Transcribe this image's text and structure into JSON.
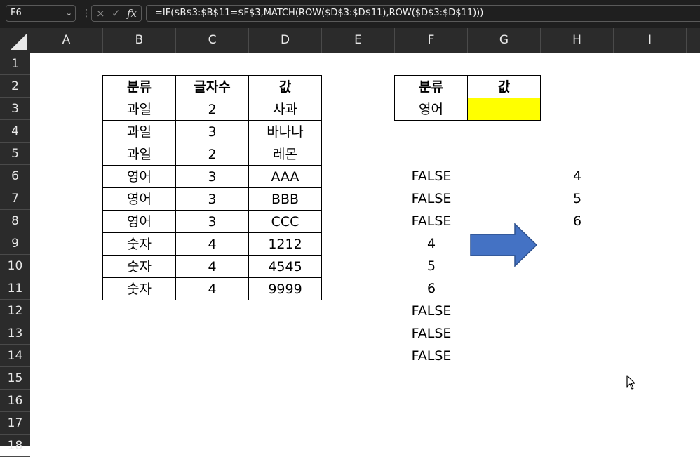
{
  "namebox": {
    "value": "F6",
    "chevron": "⌄"
  },
  "formula_bar": {
    "cancel_icon": "×",
    "enter_icon": "✓",
    "fx_label": "fx",
    "formula": "=IF($B$3:$B$11=$F$3,MATCH(ROW($D$3:$D$11),ROW($D$3:$D$11)))"
  },
  "columns": [
    "A",
    "B",
    "C",
    "D",
    "E",
    "F",
    "G",
    "H",
    "I"
  ],
  "rows": [
    "1",
    "2",
    "3",
    "4",
    "5",
    "6",
    "7",
    "8",
    "9",
    "10",
    "11",
    "12",
    "13",
    "14",
    "15",
    "16",
    "17",
    "18"
  ],
  "source_table": {
    "headers": [
      "분류",
      "글자수",
      "값"
    ],
    "rows": [
      [
        "과일",
        "2",
        "사과"
      ],
      [
        "과일",
        "3",
        "바나나"
      ],
      [
        "과일",
        "2",
        "레몬"
      ],
      [
        "영어",
        "3",
        "AAA"
      ],
      [
        "영어",
        "3",
        "BBB"
      ],
      [
        "영어",
        "3",
        "CCC"
      ],
      [
        "숫자",
        "4",
        "1212"
      ],
      [
        "숫자",
        "4",
        "4545"
      ],
      [
        "숫자",
        "4",
        "9999"
      ]
    ]
  },
  "lookup_table": {
    "headers": [
      "분류",
      "값"
    ],
    "category": "영어",
    "value": "",
    "highlight_color": "#ffff00"
  },
  "f_results": [
    "FALSE",
    "FALSE",
    "FALSE",
    "4",
    "5",
    "6",
    "FALSE",
    "FALSE",
    "FALSE"
  ],
  "h_results": [
    "4",
    "5",
    "6"
  ],
  "arrow_color": "#4472c4"
}
